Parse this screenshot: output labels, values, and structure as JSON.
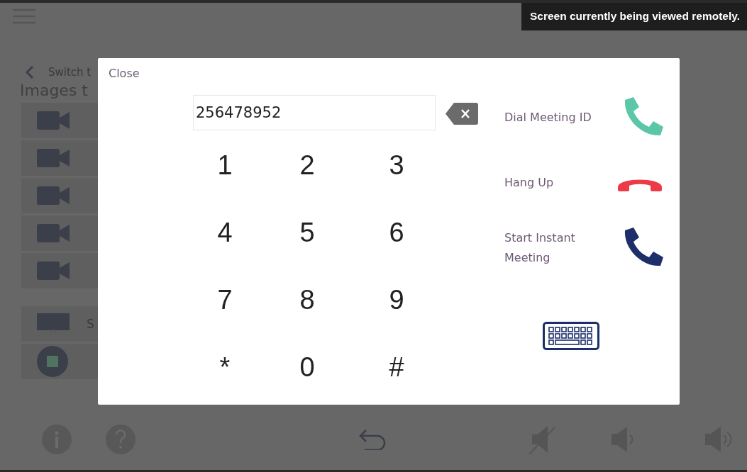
{
  "banner": "Screen currently being viewed remotely.",
  "background": {
    "back_label": "Switch t",
    "section_title": "Images t",
    "sources": [
      {
        "kind": "camera"
      },
      {
        "kind": "camera"
      },
      {
        "kind": "camera"
      },
      {
        "kind": "camera"
      },
      {
        "kind": "camera"
      }
    ],
    "controls": [
      {
        "kind": "screen",
        "label": "S"
      },
      {
        "kind": "stop"
      }
    ],
    "toolbar": [
      {
        "kind": "info"
      },
      {
        "kind": "help"
      },
      {
        "kind": "undo"
      },
      {
        "kind": "mute"
      },
      {
        "kind": "volume-down"
      },
      {
        "kind": "volume-up"
      }
    ]
  },
  "dialog": {
    "close": "Close",
    "number_field": {
      "value": "256478952"
    },
    "keys": [
      "1",
      "2",
      "3",
      "4",
      "5",
      "6",
      "7",
      "8",
      "9",
      "*",
      "0",
      "#"
    ],
    "actions": [
      {
        "kind": "dial",
        "label": "Dial Meeting ID"
      },
      {
        "kind": "hangup",
        "label": "Hang Up"
      },
      {
        "kind": "instant",
        "label": "Start Instant Meeting"
      }
    ]
  }
}
